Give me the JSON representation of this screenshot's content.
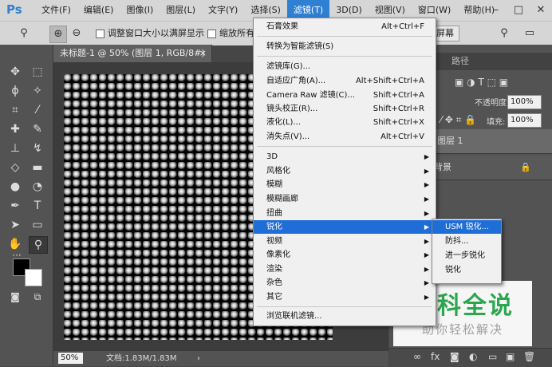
{
  "menubar": {
    "logo": "Ps",
    "items": [
      "文件(F)",
      "编辑(E)",
      "图像(I)",
      "图层(L)",
      "文字(Y)",
      "选择(S)",
      "滤镜(T)",
      "3D(D)",
      "视图(V)",
      "窗口(W)",
      "帮助(H)"
    ],
    "active_index": 6,
    "window_controls": [
      "–",
      "□",
      "✕"
    ]
  },
  "options": {
    "resize_window": "调整窗口大小以满屏显示",
    "zoom_all": "缩放所有",
    "fill_screen": "填充屏幕"
  },
  "document": {
    "tab_title": "未标题-1 @ 50% (图层 1, RGB/8#) *",
    "tab_close": "×",
    "zoom": "50%",
    "doc_info": "文档:1.83M/1.83M",
    "status_arrow": "›"
  },
  "panels": {
    "tab_path": "路径",
    "opacity_label": "不透明度:",
    "opacity_value": "100%",
    "fill_label": "填充:",
    "fill_value": "100%",
    "layer1": "图层 1",
    "background": "背景"
  },
  "filter_menu": {
    "items": [
      {
        "label": "石膏效果",
        "shortcut": "Alt+Ctrl+F"
      },
      {
        "label": "转换为智能滤镜(S)",
        "shortcut": ""
      },
      {
        "label": "滤镜库(G)...",
        "shortcut": ""
      },
      {
        "label": "自适应广角(A)...",
        "shortcut": "Alt+Shift+Ctrl+A"
      },
      {
        "label": "Camera Raw 滤镜(C)...",
        "shortcut": "Shift+Ctrl+A"
      },
      {
        "label": "镜头校正(R)...",
        "shortcut": "Shift+Ctrl+R"
      },
      {
        "label": "液化(L)...",
        "shortcut": "Shift+Ctrl+X"
      },
      {
        "label": "消失点(V)...",
        "shortcut": "Alt+Ctrl+V"
      },
      {
        "label": "3D",
        "shortcut": ""
      },
      {
        "label": "风格化",
        "shortcut": ""
      },
      {
        "label": "模糊",
        "shortcut": ""
      },
      {
        "label": "模糊画廊",
        "shortcut": ""
      },
      {
        "label": "扭曲",
        "shortcut": ""
      },
      {
        "label": "锐化",
        "shortcut": ""
      },
      {
        "label": "视频",
        "shortcut": ""
      },
      {
        "label": "像素化",
        "shortcut": ""
      },
      {
        "label": "渲染",
        "shortcut": ""
      },
      {
        "label": "杂色",
        "shortcut": ""
      },
      {
        "label": "其它",
        "shortcut": ""
      },
      {
        "label": "浏览联机滤镜...",
        "shortcut": ""
      }
    ],
    "submenu_arrow": "▶"
  },
  "sharpen_submenu": {
    "items": [
      "USM 锐化...",
      "防抖...",
      "进一步锐化",
      "锐化"
    ]
  },
  "watermark": {
    "title": "百科全说",
    "subtitle": "助你轻松解决"
  },
  "colors": {
    "accent": "#1f6dd6",
    "ps_blue": "#2f7fd2",
    "watermark_green": "#2ea64f"
  }
}
